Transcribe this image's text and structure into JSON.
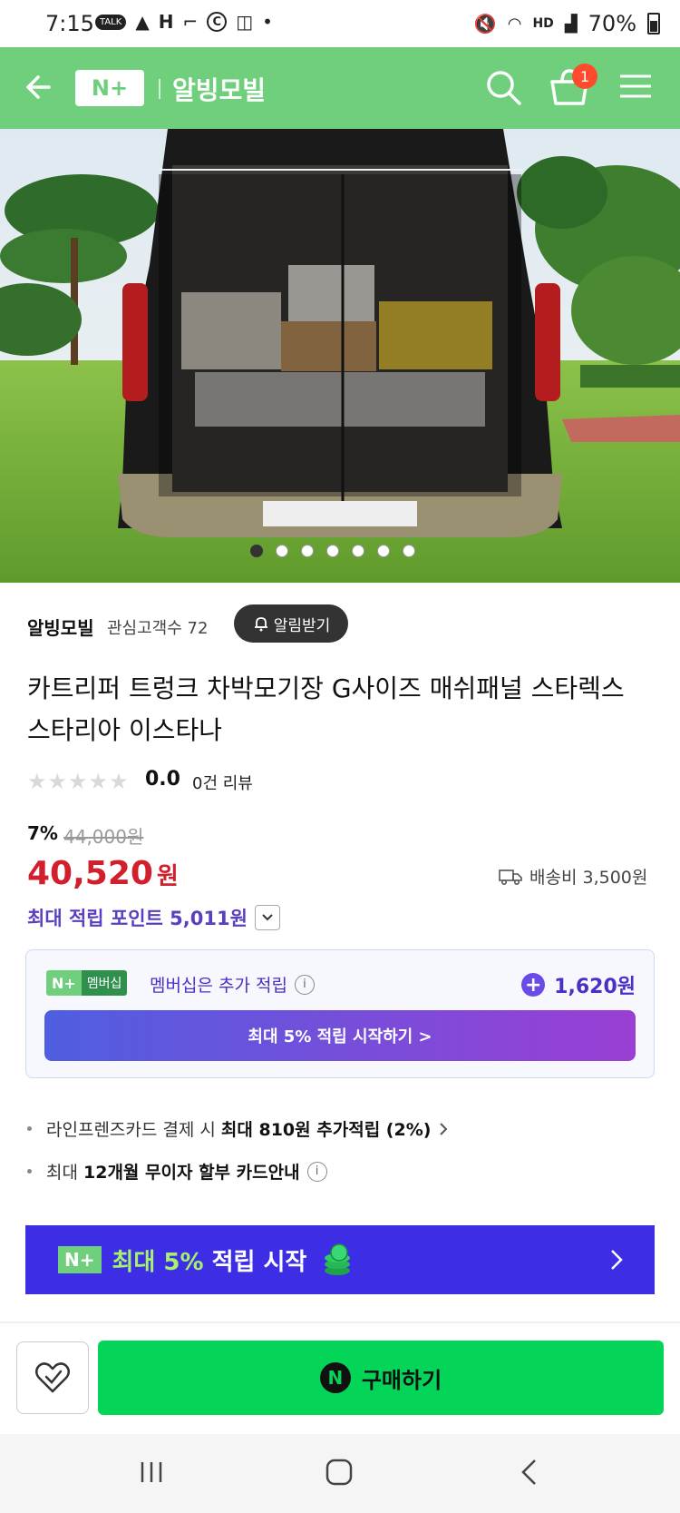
{
  "status_bar": {
    "time": "7:15",
    "notification_labels": [
      "TALK",
      "H",
      "C"
    ],
    "network_label": "HD",
    "battery": "70%"
  },
  "header": {
    "logo": "N+",
    "store_name": "알빙모빌",
    "cart_count": "1",
    "accent_color": "#6fcf7d"
  },
  "gallery": {
    "total_images": 7,
    "active_index": 0
  },
  "seller": {
    "name": "알빙모빌",
    "interest_label": "관심고객수 72",
    "alarm_button": "알림받기"
  },
  "product": {
    "title": "카트리퍼 트렁크 차박모기장 G사이즈 매쉬패널 스타렉스 스타리아 이스타나",
    "rating": "0.0",
    "review_count": "0건 리뷰",
    "stars_filled": 0,
    "stars_total": 5,
    "discount": "7%",
    "original_price": "44,000원",
    "price_value": "40,520",
    "price_unit": "원",
    "shipping": "배송비 3,500원",
    "max_points": "최대 적립 포인트 5,011원",
    "price_color": "#d11f2d",
    "points_color": "#5b3fbf"
  },
  "membership": {
    "badge_n": "N+",
    "badge_label": "멤버십",
    "text": "멤버십은 추가 적립",
    "amount": "1,620원",
    "button": "최대 5% 적립 시작하기 >"
  },
  "benefits": [
    {
      "prefix": "라인프렌즈카드 결제 시 ",
      "bold": "최대 810원 추가적립",
      "suffix": " (2%)"
    },
    {
      "prefix": "최대 ",
      "bold": "12개월 무이자 할부 카드안내",
      "suffix": ""
    }
  ],
  "banner": {
    "logo": "N+",
    "text_highlight": "최대 5%",
    "text_rest": " 적립 시작",
    "background": "#3d2ee6"
  },
  "bottom": {
    "buy_button": "구매하기",
    "buy_icon": "N",
    "buy_color": "#04d559"
  }
}
